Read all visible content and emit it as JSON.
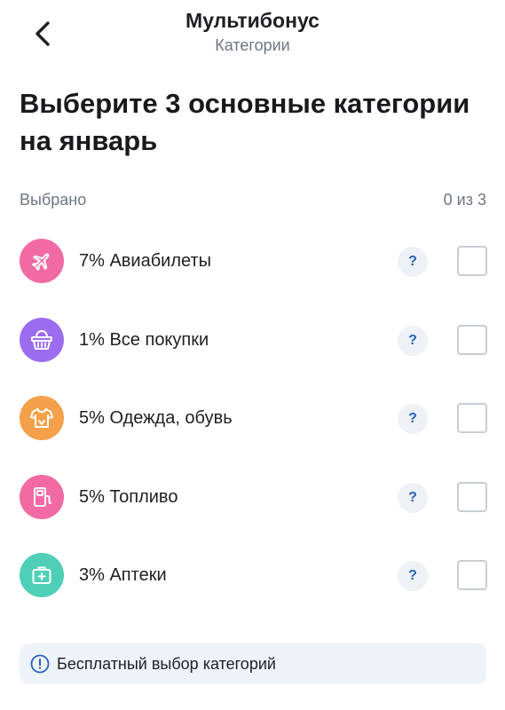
{
  "header": {
    "title": "Мультибонус",
    "subtitle": "Категории"
  },
  "heading": "Выберите 3 основные категории на январь",
  "selection": {
    "label": "Выбрано",
    "count": "0 из 3"
  },
  "categories": [
    {
      "label": "7% Авиабилеты",
      "icon": "airplane-icon",
      "color": "#f26aa3",
      "help": "?",
      "checked": false
    },
    {
      "label": "1% Все покупки",
      "icon": "basket-icon",
      "color": "#9b6cf0",
      "help": "?",
      "checked": false
    },
    {
      "label": "5% Одежда, обувь",
      "icon": "tshirt-icon",
      "color": "#f5a04a",
      "help": "?",
      "checked": false
    },
    {
      "label": "5% Топливо",
      "icon": "fuel-icon",
      "color": "#f26aa3",
      "help": "?",
      "checked": false
    },
    {
      "label": "3% Аптеки",
      "icon": "medkit-icon",
      "color": "#4fcfb7",
      "help": "?",
      "checked": false
    }
  ],
  "info_banner": {
    "text": "Бесплатный выбор категорий",
    "icon": "info-icon"
  },
  "colors": {
    "accent": "#2b5fb7",
    "banner_bg": "#eef3fa",
    "muted_text": "#6e7582"
  }
}
